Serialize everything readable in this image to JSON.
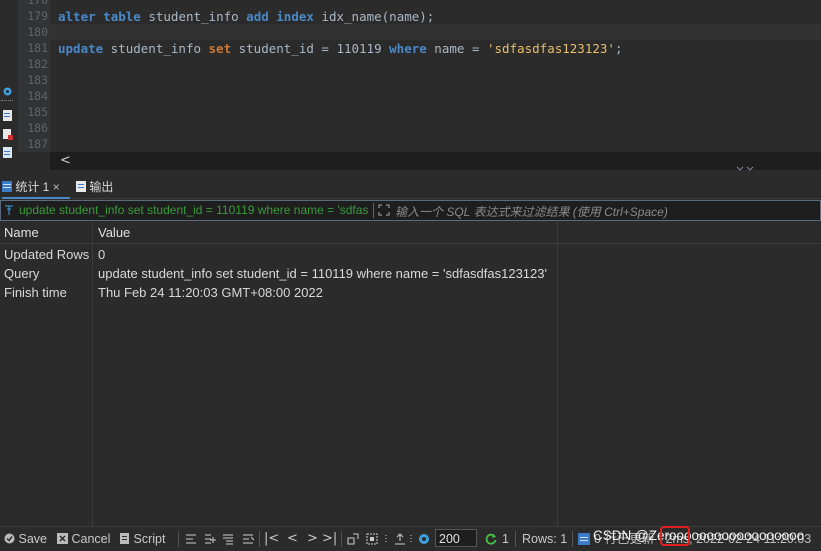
{
  "editor": {
    "line_numbers": [
      "178",
      "179",
      "180",
      "181",
      "182",
      "183",
      "184",
      "185",
      "186",
      "187"
    ],
    "line179": {
      "k1": "alter",
      "k2": "table",
      "t1": " student_info ",
      "k3": "add",
      "k4": "index",
      "t2": " idx_name(name);"
    },
    "line181": {
      "k1": "update",
      "t1": " student_info ",
      "k2": "set",
      "t2": " student_id = 110119 ",
      "k3": "where",
      "t3": " name = ",
      "s1": "'sdfasdfas123123'",
      "t4": ";"
    },
    "hscroll_arrow": "<"
  },
  "tabs": [
    {
      "label": "统计 1",
      "close": "×",
      "icon": "table-icon"
    },
    {
      "label": "输出",
      "icon": "output-icon"
    }
  ],
  "filter": {
    "value": "update student_info set student_id = 110119 where name = 'sdfasdfas123123'",
    "placeholder": "输入一个 SQL 表达式来过滤结果 (使用 Ctrl+Space)"
  },
  "grid": {
    "headers": [
      "Name",
      "Value"
    ],
    "rows": [
      {
        "name": "Updated Rows",
        "value": "0"
      },
      {
        "name": "Query",
        "value": "update student_info set student_id = 110119 where name = 'sdfasdfas123123'"
      },
      {
        "name": "Finish time",
        "value": "Thu Feb 24 11:20:03 GMT+08:00 2022"
      }
    ]
  },
  "status": {
    "save": "Save",
    "cancel": "Cancel",
    "script": "Script",
    "fetch_size": "200",
    "refresh_count": "1",
    "rows": "Rows: 1",
    "updated": "0 行已更新 - 2ms, 2022-02-24 11:20:03"
  },
  "watermark": "CSDN @Zeroooooooooooooooooo",
  "colors": {
    "accent": "#4a88c7",
    "highlight": "#e02020"
  }
}
